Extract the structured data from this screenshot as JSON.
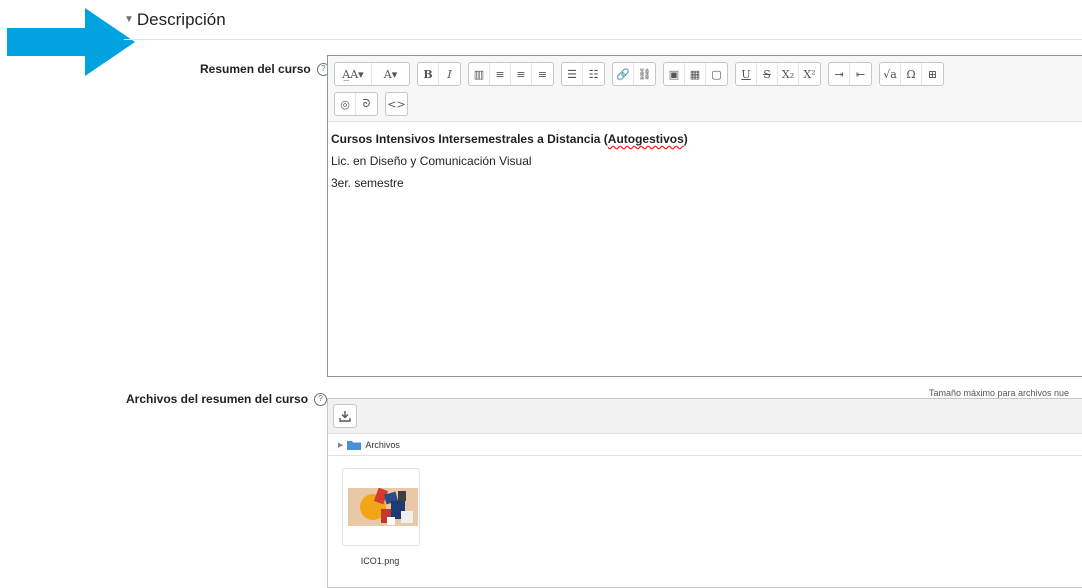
{
  "section": {
    "title": "Descripción"
  },
  "summary": {
    "label": "Resumen del curso",
    "toolbar_row1": [
      {
        "name": "font-family-button",
        "icon": "font-family-icon",
        "glyph": "A̲A▾",
        "wide": true
      },
      {
        "name": "font-color-button",
        "icon": "font-color-icon",
        "glyph": "A▾",
        "wide": true
      },
      {
        "name": "bold-button",
        "icon": "bold-icon",
        "glyph": "B"
      },
      {
        "name": "italic-button",
        "icon": "italic-icon",
        "glyph": "I"
      },
      {
        "name": "table-columns-button",
        "icon": "columns-icon",
        "glyph": "▥"
      },
      {
        "name": "align-left-button",
        "icon": "align-left-icon",
        "glyph": "≡"
      },
      {
        "name": "align-center-button",
        "icon": "align-center-icon",
        "glyph": "≡"
      },
      {
        "name": "align-right-button",
        "icon": "align-right-icon",
        "glyph": "≡"
      },
      {
        "name": "unordered-list-button",
        "icon": "bullet-list-icon",
        "glyph": "☰"
      },
      {
        "name": "ordered-list-button",
        "icon": "numbered-list-icon",
        "glyph": "☷"
      },
      {
        "name": "link-button",
        "icon": "link-icon",
        "glyph": "🔗"
      },
      {
        "name": "unlink-button",
        "icon": "unlink-icon",
        "glyph": "⛓"
      },
      {
        "name": "image-button",
        "icon": "image-icon",
        "glyph": "▣"
      },
      {
        "name": "media-button",
        "icon": "media-icon",
        "glyph": "▦"
      },
      {
        "name": "manage-files-button",
        "icon": "clipboard-icon",
        "glyph": "▢"
      },
      {
        "name": "underline-button",
        "icon": "underline-icon",
        "glyph": "U"
      },
      {
        "name": "strikethrough-button",
        "icon": "strikethrough-icon",
        "glyph": "S"
      },
      {
        "name": "subscript-button",
        "icon": "subscript-icon",
        "glyph": "X₂"
      },
      {
        "name": "superscript-button",
        "icon": "superscript-icon",
        "glyph": "X²"
      },
      {
        "name": "indent-button",
        "icon": "indent-icon",
        "glyph": "⇥"
      },
      {
        "name": "outdent-button",
        "icon": "outdent-icon",
        "glyph": "⇤"
      },
      {
        "name": "equation-button",
        "icon": "equation-icon",
        "glyph": "√a"
      },
      {
        "name": "special-character-button",
        "icon": "omega-icon",
        "glyph": "Ω"
      },
      {
        "name": "table-button",
        "icon": "table-icon",
        "glyph": "⊞"
      }
    ],
    "toolbar_row2": [
      {
        "name": "accessibility-checker-button",
        "icon": "eye-slash-icon",
        "glyph": "◎"
      },
      {
        "name": "screenreader-helper-button",
        "icon": "ear-icon",
        "glyph": "ᘐ"
      },
      {
        "name": "html-source-button",
        "icon": "code-icon",
        "glyph": "<>"
      }
    ],
    "content_line1_prefix": "Cursos Intensivos Intersemestrales a Distancia (",
    "content_line1_misspelled": "Autogestivos",
    "content_line1_suffix": ")",
    "content_line2": "Lic. en Diseño y Comunicación Visual",
    "content_line3": "3er. semestre"
  },
  "files": {
    "label": "Archivos del resumen del curso",
    "max_size_text": "Tamaño máximo para archivos nue",
    "folder_label": "Archivos",
    "file_name": "ICO1.png"
  },
  "colors": {
    "arrow": "#00a3e0",
    "folder": "#4a90d9"
  }
}
